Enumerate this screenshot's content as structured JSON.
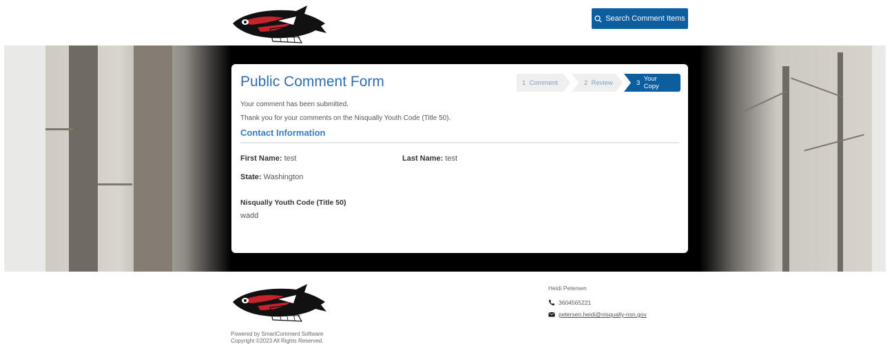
{
  "header": {
    "search_button_label": "Search Comment Items"
  },
  "form": {
    "title": "Public Comment Form",
    "steps": [
      {
        "number": "1",
        "label": "Comment"
      },
      {
        "number": "2",
        "label": "Review"
      },
      {
        "number": "3",
        "label": "Your Copy"
      }
    ],
    "active_step": 3,
    "submitted_message": "Your comment has been submitted.",
    "thanks_message": "Thank you for your comments on the Nisqually Youth Code (Title 50).",
    "contact_section_title": "Contact Information",
    "first_name_label": "First Name:",
    "first_name_value": "test",
    "last_name_label": "Last Name:",
    "last_name_value": "test",
    "state_label": "State:",
    "state_value": "Washington",
    "comment_item_title": "Nisqually Youth Code (Title 50)",
    "comment_item_value": "wadd"
  },
  "footer": {
    "powered_by": "Powered by SmartComment Software",
    "copyright": "Copyright ©2023 All Rights Reserved.",
    "contact_name": "Heidi Petersen",
    "contact_phone": "3604565221",
    "contact_email": "petersen.heidi@nisqually-nsn.gov"
  },
  "colors": {
    "accent": "#0c5e9e",
    "title": "#2f6eae",
    "section": "#3a7cc2"
  },
  "icons": [
    "search-icon",
    "phone-icon",
    "envelope-icon",
    "salmon-logo"
  ]
}
